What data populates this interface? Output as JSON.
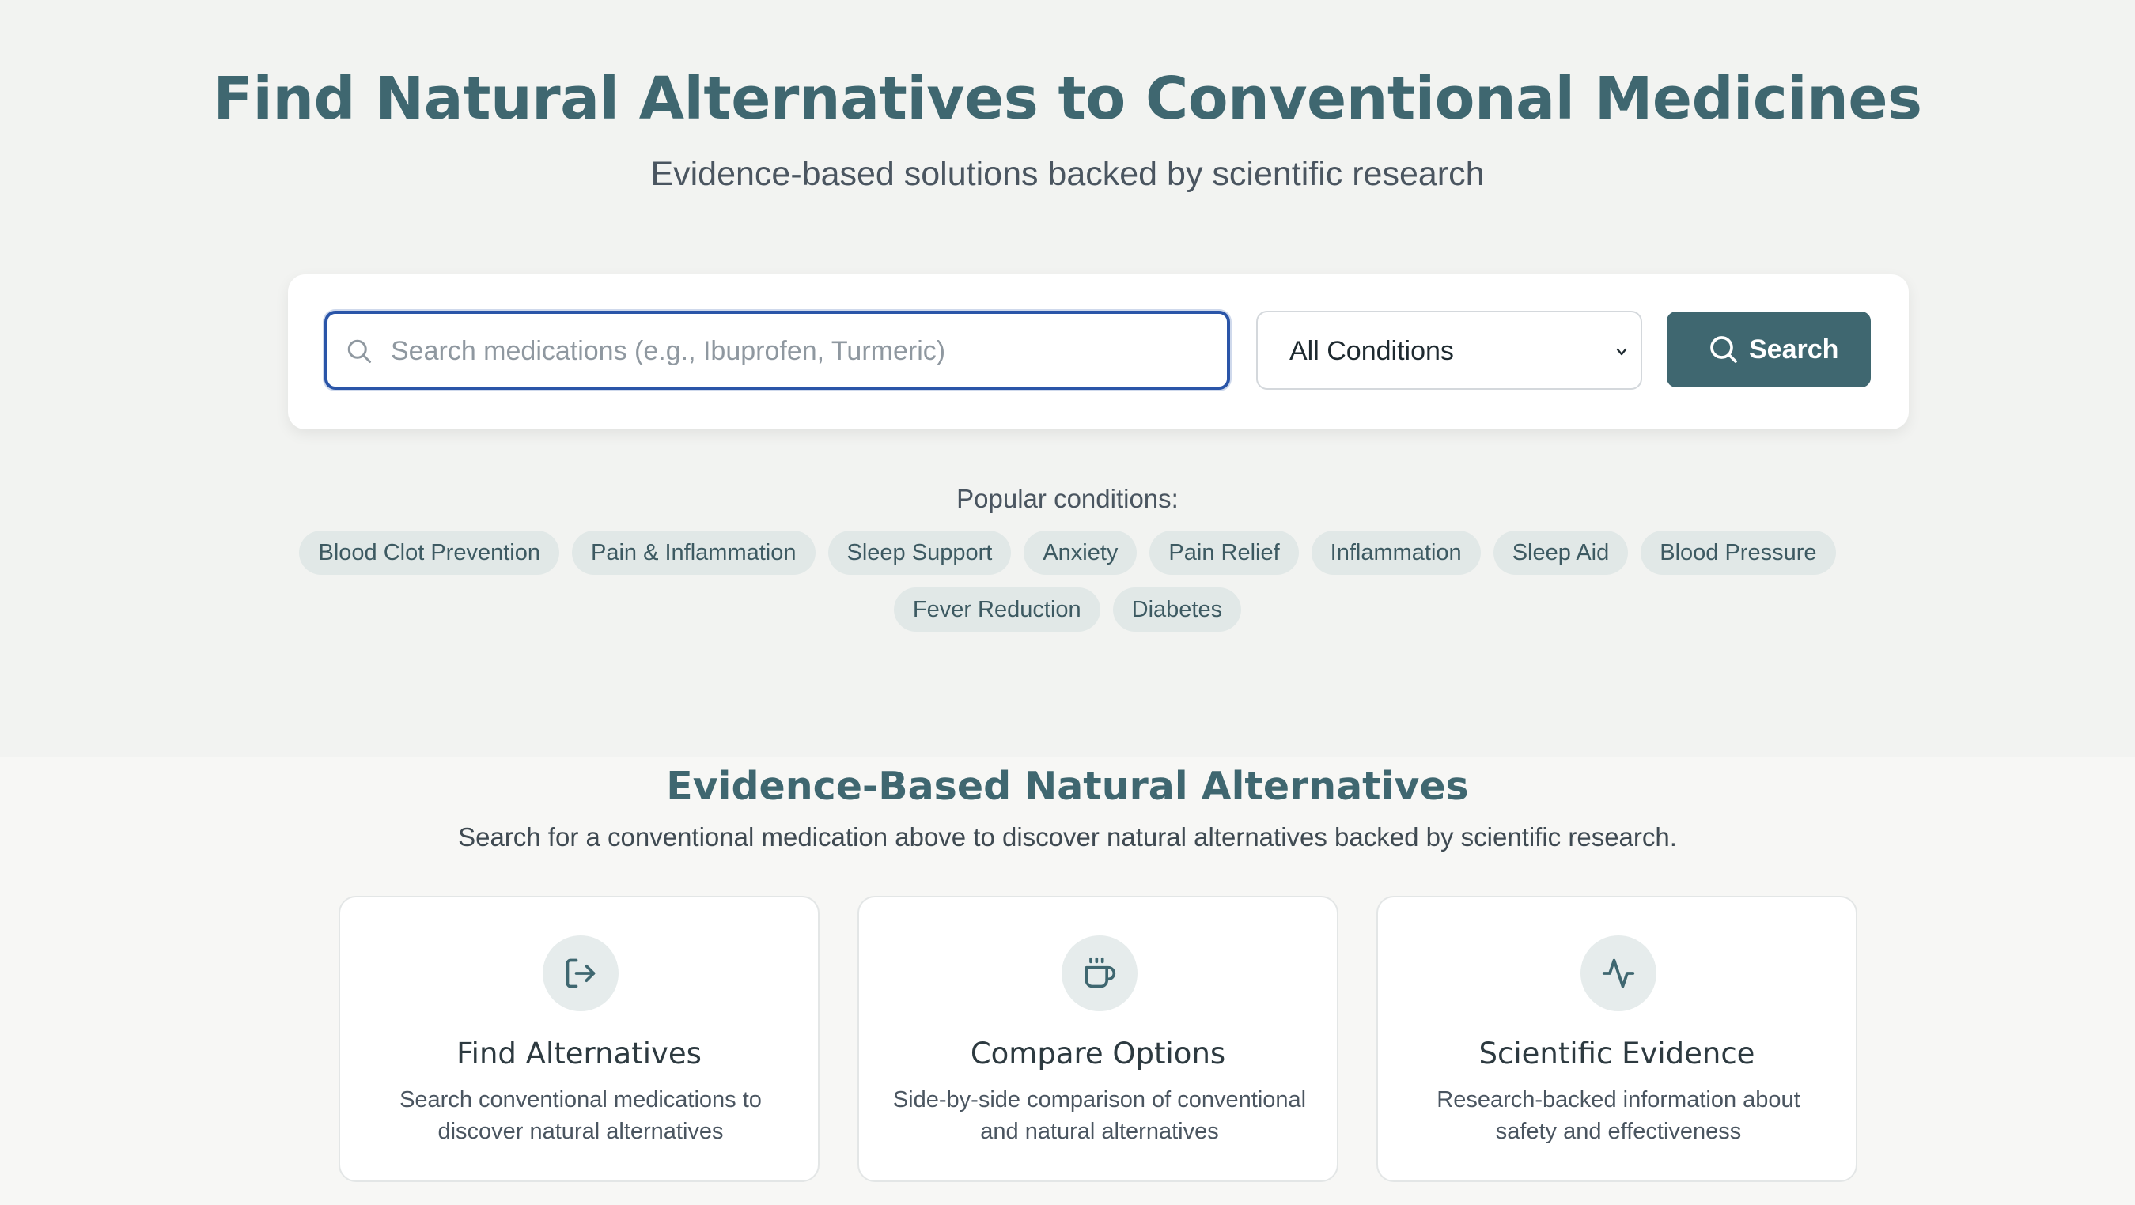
{
  "hero": {
    "title": "Find Natural Alternatives to Conventional Medicines",
    "subtitle": "Evidence-based solutions backed by scientific research"
  },
  "search": {
    "placeholder": "Search medications (e.g., Ibuprofen, Turmeric)",
    "value": "",
    "condition_selected": "All Conditions",
    "button_label": "Search",
    "icons": {
      "field": "search-icon",
      "select": "chevron-down-icon",
      "button": "search-icon"
    }
  },
  "popular": {
    "label": "Popular conditions:",
    "row1": [
      "Blood Clot Prevention",
      "Pain & Inflammation",
      "Sleep Support",
      "Anxiety",
      "Pain Relief",
      "Inflammation",
      "Sleep Aid",
      "Blood Pressure"
    ],
    "row2": [
      "Fever Reduction",
      "Diabetes"
    ]
  },
  "section": {
    "title": "Evidence-Based Natural Alternatives",
    "subtitle": "Search for a conventional medication above to discover natural alternatives backed by scientific research."
  },
  "features": [
    {
      "icon": "exit-arrow-icon",
      "title": "Find Alternatives",
      "description": "Search conventional medications to discover natural alternatives"
    },
    {
      "icon": "coffee-cup-icon",
      "title": "Compare Options",
      "description": "Side-by-side comparison of conventional and natural alternatives"
    },
    {
      "icon": "activity-pulse-icon",
      "title": "Scientific Evidence",
      "description": "Research-backed information about safety and effectiveness"
    }
  ],
  "colors": {
    "accent": "#3f6770",
    "background": "#f2f3f1",
    "chip": "#e1e8e7",
    "focus_border": "#2a55a8"
  }
}
